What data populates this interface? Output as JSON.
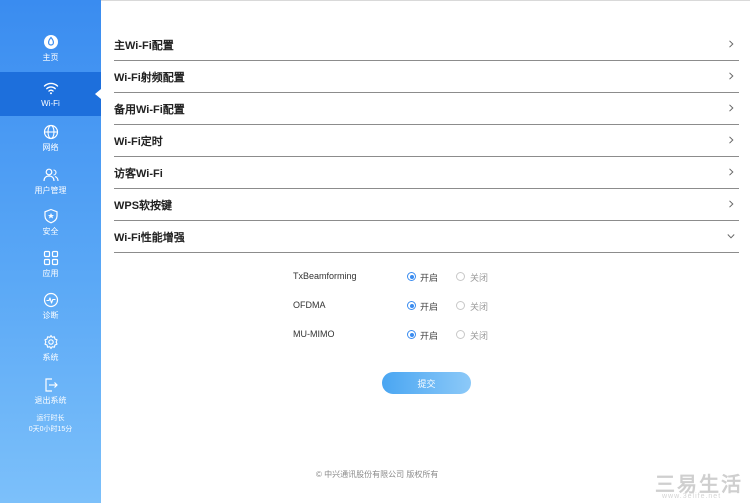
{
  "nav": [
    {
      "label": "主页",
      "icon": "home-icon",
      "active": false
    },
    {
      "label": "Wi-Fi",
      "icon": "wifi-icon",
      "active": true
    },
    {
      "label": "网络",
      "icon": "globe-icon",
      "active": false
    },
    {
      "label": "用户管理",
      "icon": "users-icon",
      "active": false
    },
    {
      "label": "安全",
      "icon": "shield-icon",
      "active": false
    },
    {
      "label": "应用",
      "icon": "apps-grid-icon",
      "active": false
    },
    {
      "label": "诊断",
      "icon": "diagnosis-icon",
      "active": false
    },
    {
      "label": "系统",
      "icon": "gear-icon",
      "active": false
    },
    {
      "label": "退出系统",
      "icon": "logout-icon",
      "active": false
    }
  ],
  "uptime": {
    "label": "运行时长",
    "value": "0天0小时15分"
  },
  "sections": [
    {
      "title": "主Wi-Fi配置",
      "expanded": false
    },
    {
      "title": "Wi-Fi射频配置",
      "expanded": false
    },
    {
      "title": "备用Wi-Fi配置",
      "expanded": false
    },
    {
      "title": "Wi-Fi定时",
      "expanded": false
    },
    {
      "title": "访客Wi-Fi",
      "expanded": false
    },
    {
      "title": "WPS软按键",
      "expanded": false
    },
    {
      "title": "Wi-Fi性能增强",
      "expanded": true
    }
  ],
  "options": [
    {
      "label": "TxBeamforming",
      "on_label": "开启",
      "off_label": "关闭",
      "selected": "on"
    },
    {
      "label": "OFDMA",
      "on_label": "开启",
      "off_label": "关闭",
      "selected": "on"
    },
    {
      "label": "MU-MIMO",
      "on_label": "开启",
      "off_label": "关闭",
      "selected": "on"
    }
  ],
  "submit_label": "提交",
  "footer": "© 中兴通讯股份有限公司 版权所有",
  "watermark": {
    "text": "三易生活",
    "url": "www.3elife.net"
  },
  "colors": {
    "accent": "#3a8cf0",
    "sidebar_active": "#1d6fdc"
  }
}
